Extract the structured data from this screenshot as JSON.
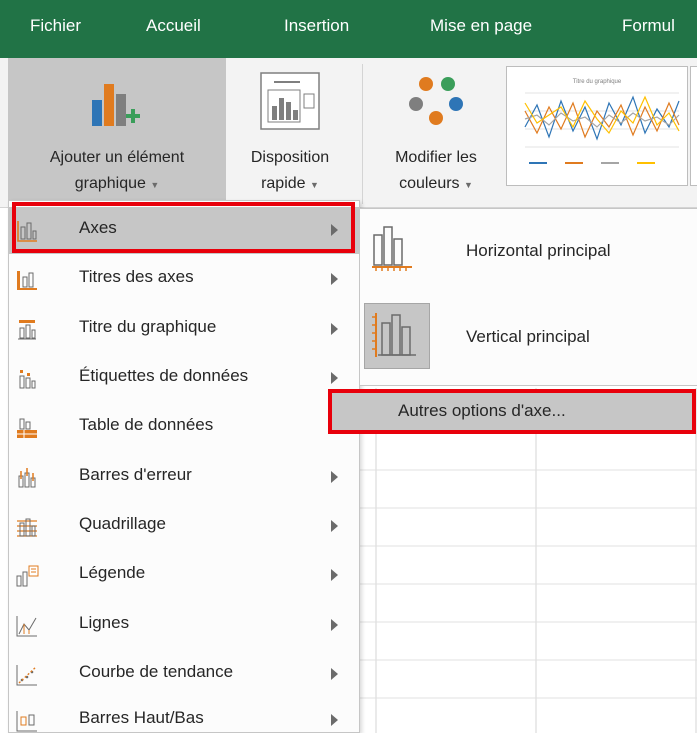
{
  "ribbon_tabs": [
    "Fichier",
    "Accueil",
    "Insertion",
    "Mise en page",
    "Formul"
  ],
  "ribbon": {
    "add_element": {
      "line1": "Ajouter un élément",
      "line2": "graphique"
    },
    "quick_layout": {
      "line1": "Disposition",
      "line2": "rapide"
    },
    "change_colors": {
      "line1": "Modifier les",
      "line2": "couleurs"
    },
    "gallery_preview_title": "Titre du graphique"
  },
  "menu": {
    "items": [
      {
        "label": "Axes",
        "icon": "axes-icon",
        "selected": true
      },
      {
        "label": "Titres des axes",
        "icon": "axis-titles-icon"
      },
      {
        "label": "Titre du graphique",
        "icon": "chart-title-icon"
      },
      {
        "label": "Étiquettes de données",
        "icon": "data-labels-icon"
      },
      {
        "label": "Table de données",
        "icon": "data-table-icon"
      },
      {
        "label": "Barres d'erreur",
        "icon": "error-bars-icon"
      },
      {
        "label": "Quadrillage",
        "icon": "gridlines-icon"
      },
      {
        "label": "Légende",
        "icon": "legend-icon"
      },
      {
        "label": "Lignes",
        "icon": "lines-icon"
      },
      {
        "label": "Courbe de tendance",
        "icon": "trendline-icon"
      },
      {
        "label": "Barres Haut/Bas",
        "icon": "up-down-bars-icon"
      }
    ]
  },
  "submenu": {
    "horizontal": "Horizontal principal",
    "vertical": "Vertical principal",
    "more_options": "Autres options d'axe..."
  },
  "colors": {
    "tab_bar": "#217346",
    "highlight_border": "#e8000b",
    "hover_bg": "#c6c6c6",
    "icon_orange": "#e07b1f",
    "icon_blue": "#2e75b6"
  }
}
